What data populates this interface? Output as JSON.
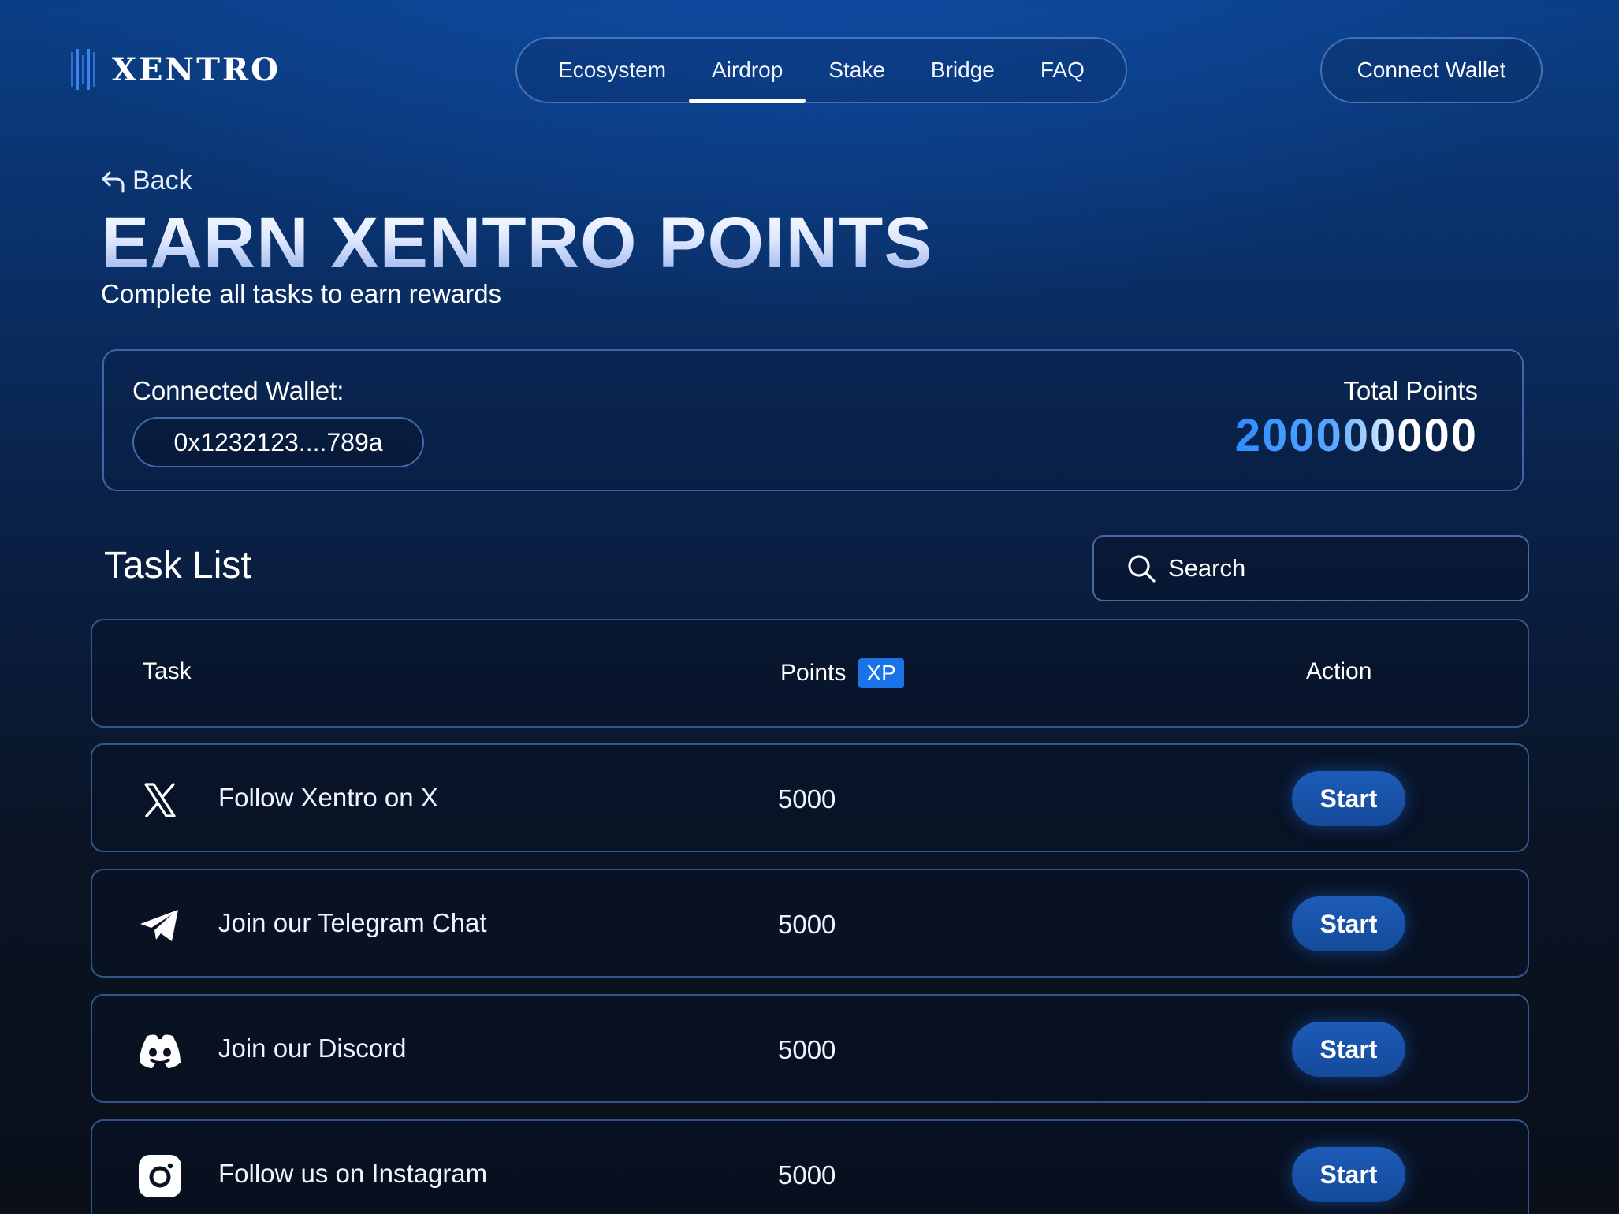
{
  "brand": {
    "name": "XENTRO"
  },
  "nav": {
    "items": [
      {
        "label": "Ecosystem",
        "active": false
      },
      {
        "label": "Airdrop",
        "active": true
      },
      {
        "label": "Stake",
        "active": false
      },
      {
        "label": "Bridge",
        "active": false
      },
      {
        "label": "FAQ",
        "active": false
      }
    ],
    "connect_label": "Connect Wallet"
  },
  "header": {
    "back_label": "Back",
    "title": "EARN XENTRO POINTS",
    "subtitle": "Complete all tasks to earn rewards"
  },
  "wallet": {
    "label": "Connected Wallet:",
    "address": "0x1232123....789a",
    "total_label": "Total Points",
    "total_value": "200000000"
  },
  "tasks": {
    "title": "Task List",
    "search_placeholder": "Search",
    "columns": {
      "task": "Task",
      "points": "Points",
      "points_badge": "XP",
      "action": "Action"
    },
    "rows": [
      {
        "icon": "x-icon",
        "label": "Follow Xentro on X",
        "points": "5000",
        "action": "Start"
      },
      {
        "icon": "telegram-icon",
        "label": "Join our Telegram Chat",
        "points": "5000",
        "action": "Start"
      },
      {
        "icon": "discord-icon",
        "label": "Join our Discord",
        "points": "5000",
        "action": "Start"
      },
      {
        "icon": "instagram-icon",
        "label": "Follow us on Instagram",
        "points": "5000",
        "action": "Start"
      }
    ]
  },
  "colors": {
    "accent": "#1a73e8",
    "button": "#1c5cb8",
    "border": "#5a8cdc",
    "background_top": "#0b3f86",
    "background_bottom": "#0a0f19"
  }
}
